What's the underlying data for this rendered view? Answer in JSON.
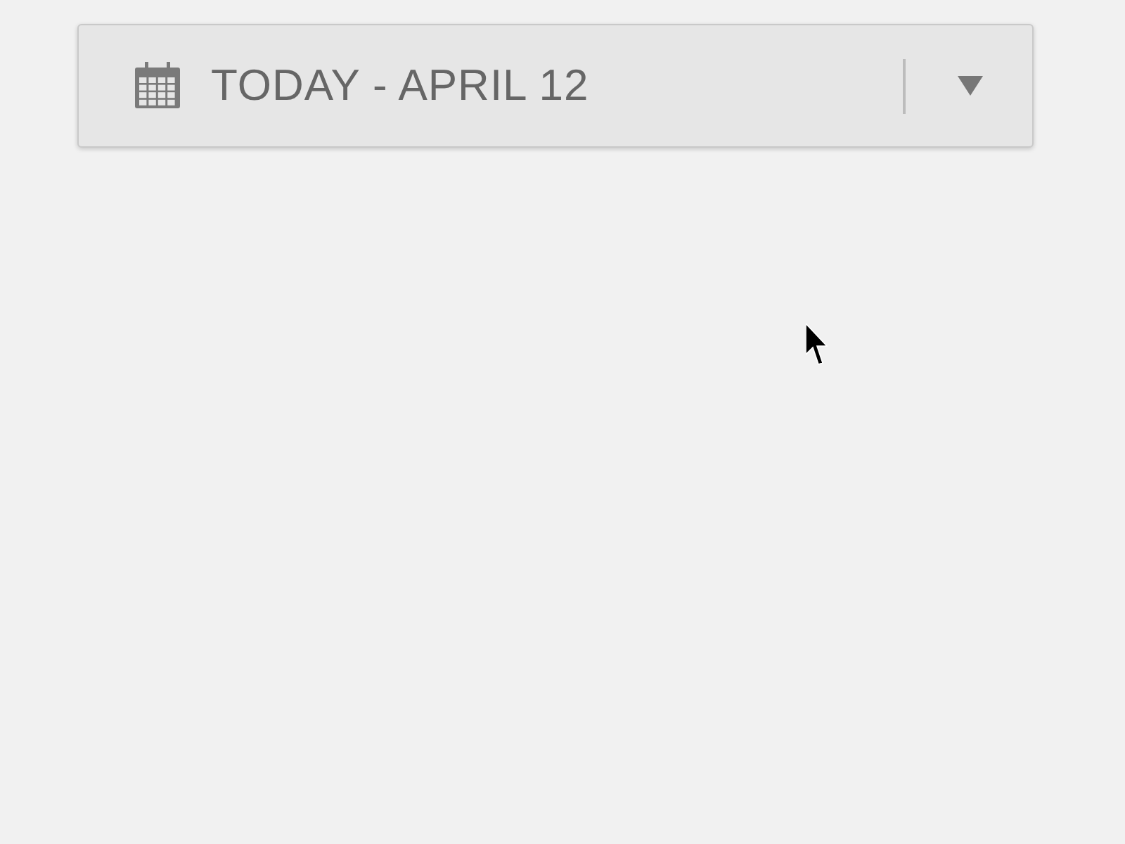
{
  "date_dropdown": {
    "label": "TODAY - APRIL 12"
  }
}
